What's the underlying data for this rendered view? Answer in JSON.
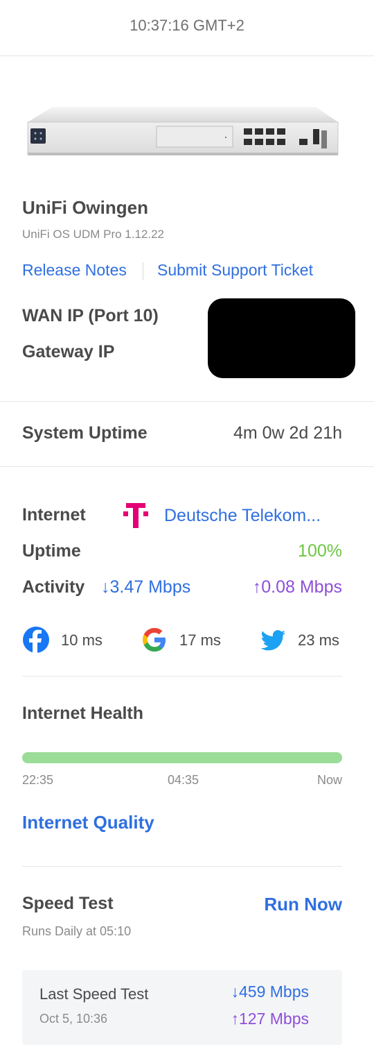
{
  "header": {
    "time": "10:37:16 GMT+2"
  },
  "device": {
    "image_icon": "udm-pro-device",
    "name": "UniFi Owingen",
    "subtitle": "UniFi OS UDM Pro 1.12.22",
    "release_notes": "Release Notes",
    "support_ticket": "Submit Support Ticket",
    "wan_ip_label": "WAN IP (Port 10)",
    "gateway_ip_label": "Gateway IP"
  },
  "system": {
    "uptime_label": "System Uptime",
    "uptime_value": "4m 0w 2d 21h"
  },
  "internet": {
    "label": "Internet",
    "isp_icon": "telekom-logo",
    "isp_color": "#e20074",
    "isp": "Deutsche Telekom...",
    "uptime_label": "Uptime",
    "uptime_value": "100%",
    "activity_label": "Activity",
    "download": "↓3.47 Mbps",
    "upload": "↑0.08 Mbps",
    "pings": [
      {
        "icon": "facebook-icon",
        "value": "10 ms"
      },
      {
        "icon": "google-icon",
        "value": "17 ms"
      },
      {
        "icon": "twitter-icon",
        "value": "23 ms"
      }
    ]
  },
  "health": {
    "label": "Internet Health",
    "bar_color": "#9bdc98",
    "ticks": [
      "22:35",
      "04:35",
      "Now"
    ],
    "quality_link": "Internet Quality"
  },
  "speed_test": {
    "label": "Speed Test",
    "run_now": "Run Now",
    "schedule": "Runs Daily at 05:10",
    "last_label": "Last Speed Test",
    "last_date": "Oct 5, 10:36",
    "last_down": "↓459 Mbps",
    "last_up": "↑127 Mbps"
  },
  "colors": {
    "accent": "#2f6fe0",
    "upload": "#8e4fd9",
    "good": "#6cc644"
  }
}
